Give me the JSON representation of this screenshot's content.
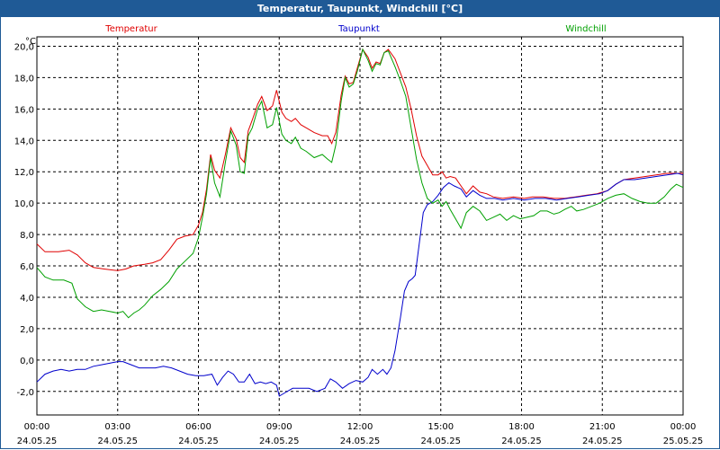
{
  "window_title": "Temperatur, Taupunkt, Windchill [°C]",
  "chart_data": {
    "type": "line",
    "title": "Temperatur, Taupunkt, Windchill [°C]",
    "ylabel": "°C",
    "ylim": [
      -3.5,
      20.6
    ],
    "yticks": [
      "20,0",
      "18,0",
      "16,0",
      "14,0",
      "12,0",
      "10,0",
      "8,0",
      "6,0",
      "4,0",
      "2,0",
      "0,0",
      "-2,0"
    ],
    "xlim": [
      0,
      24
    ],
    "xticks": [
      {
        "time": "00:00",
        "date": "24.05.25"
      },
      {
        "time": "03:00",
        "date": "24.05.25"
      },
      {
        "time": "06:00",
        "date": "24.05.25"
      },
      {
        "time": "09:00",
        "date": "24.05.25"
      },
      {
        "time": "12:00",
        "date": "24.05.25"
      },
      {
        "time": "15:00",
        "date": "24.05.25"
      },
      {
        "time": "18:00",
        "date": "24.05.25"
      },
      {
        "time": "21:00",
        "date": "24.05.25"
      },
      {
        "time": "00:00",
        "date": "25.05.25"
      }
    ],
    "grid": true,
    "legend_position": "top",
    "series": [
      {
        "name": "Temperatur",
        "color": "#e00000",
        "points": [
          [
            0,
            7.4
          ],
          [
            0.3,
            6.9
          ],
          [
            0.8,
            6.9
          ],
          [
            1.2,
            7.0
          ],
          [
            1.5,
            6.7
          ],
          [
            1.8,
            6.2
          ],
          [
            2.1,
            5.9
          ],
          [
            2.5,
            5.8
          ],
          [
            3.0,
            5.7
          ],
          [
            3.3,
            5.8
          ],
          [
            3.6,
            6.0
          ],
          [
            4.0,
            6.1
          ],
          [
            4.3,
            6.2
          ],
          [
            4.6,
            6.4
          ],
          [
            4.9,
            7.0
          ],
          [
            5.2,
            7.7
          ],
          [
            5.5,
            7.9
          ],
          [
            5.8,
            8.0
          ],
          [
            6.0,
            8.6
          ],
          [
            6.15,
            9.4
          ],
          [
            6.3,
            10.9
          ],
          [
            6.45,
            13.1
          ],
          [
            6.6,
            12.1
          ],
          [
            6.8,
            11.6
          ],
          [
            7.0,
            13.1
          ],
          [
            7.2,
            14.8
          ],
          [
            7.4,
            14.1
          ],
          [
            7.55,
            12.9
          ],
          [
            7.7,
            12.6
          ],
          [
            7.85,
            14.6
          ],
          [
            8.0,
            15.3
          ],
          [
            8.2,
            16.3
          ],
          [
            8.35,
            16.8
          ],
          [
            8.55,
            15.9
          ],
          [
            8.75,
            16.2
          ],
          [
            8.9,
            17.2
          ],
          [
            9.1,
            15.8
          ],
          [
            9.25,
            15.4
          ],
          [
            9.45,
            15.2
          ],
          [
            9.6,
            15.4
          ],
          [
            9.8,
            15.0
          ],
          [
            10.0,
            14.8
          ],
          [
            10.3,
            14.5
          ],
          [
            10.6,
            14.3
          ],
          [
            10.8,
            14.3
          ],
          [
            10.95,
            13.8
          ],
          [
            11.1,
            14.5
          ],
          [
            11.3,
            16.9
          ],
          [
            11.45,
            18.1
          ],
          [
            11.6,
            17.6
          ],
          [
            11.75,
            17.7
          ],
          [
            11.9,
            18.6
          ],
          [
            12.1,
            19.8
          ],
          [
            12.3,
            19.3
          ],
          [
            12.45,
            18.6
          ],
          [
            12.6,
            19.0
          ],
          [
            12.75,
            18.9
          ],
          [
            12.9,
            19.6
          ],
          [
            13.05,
            19.8
          ],
          [
            13.3,
            19.2
          ],
          [
            13.5,
            18.3
          ],
          [
            13.7,
            17.4
          ],
          [
            13.9,
            16.0
          ],
          [
            14.1,
            14.3
          ],
          [
            14.3,
            13.0
          ],
          [
            14.5,
            12.4
          ],
          [
            14.7,
            11.8
          ],
          [
            14.9,
            11.8
          ],
          [
            15.05,
            12.0
          ],
          [
            15.2,
            11.6
          ],
          [
            15.35,
            11.7
          ],
          [
            15.55,
            11.6
          ],
          [
            15.75,
            11.1
          ],
          [
            15.95,
            10.6
          ],
          [
            16.2,
            11.1
          ],
          [
            16.45,
            10.7
          ],
          [
            16.7,
            10.6
          ],
          [
            16.95,
            10.4
          ],
          [
            17.3,
            10.3
          ],
          [
            17.7,
            10.4
          ],
          [
            18.1,
            10.3
          ],
          [
            18.4,
            10.4
          ],
          [
            18.8,
            10.4
          ],
          [
            19.2,
            10.3
          ],
          [
            19.6,
            10.3
          ],
          [
            20.0,
            10.4
          ],
          [
            20.4,
            10.5
          ],
          [
            20.8,
            10.6
          ],
          [
            21.2,
            10.8
          ],
          [
            21.5,
            11.2
          ],
          [
            21.8,
            11.5
          ],
          [
            22.2,
            11.6
          ],
          [
            22.6,
            11.7
          ],
          [
            23.0,
            11.8
          ],
          [
            23.4,
            11.9
          ],
          [
            23.8,
            11.9
          ],
          [
            24,
            11.9
          ]
        ]
      },
      {
        "name": "Taupunkt",
        "color": "#0000cc",
        "points": [
          [
            0,
            -1.4
          ],
          [
            0.3,
            -0.9
          ],
          [
            0.6,
            -0.7
          ],
          [
            0.9,
            -0.6
          ],
          [
            1.2,
            -0.7
          ],
          [
            1.5,
            -0.6
          ],
          [
            1.8,
            -0.6
          ],
          [
            2.1,
            -0.4
          ],
          [
            2.4,
            -0.3
          ],
          [
            2.7,
            -0.2
          ],
          [
            3.0,
            -0.1
          ],
          [
            3.2,
            -0.1
          ],
          [
            3.5,
            -0.3
          ],
          [
            3.8,
            -0.5
          ],
          [
            4.1,
            -0.5
          ],
          [
            4.4,
            -0.5
          ],
          [
            4.7,
            -0.4
          ],
          [
            5.0,
            -0.5
          ],
          [
            5.3,
            -0.7
          ],
          [
            5.6,
            -0.9
          ],
          [
            5.9,
            -1.0
          ],
          [
            6.2,
            -1.0
          ],
          [
            6.5,
            -0.9
          ],
          [
            6.7,
            -1.6
          ],
          [
            6.9,
            -1.1
          ],
          [
            7.1,
            -0.7
          ],
          [
            7.3,
            -0.9
          ],
          [
            7.5,
            -1.4
          ],
          [
            7.7,
            -1.4
          ],
          [
            7.9,
            -0.9
          ],
          [
            8.1,
            -1.5
          ],
          [
            8.3,
            -1.4
          ],
          [
            8.5,
            -1.5
          ],
          [
            8.7,
            -1.4
          ],
          [
            8.9,
            -1.6
          ],
          [
            9.0,
            -2.3
          ],
          [
            9.2,
            -2.1
          ],
          [
            9.5,
            -1.8
          ],
          [
            9.8,
            -1.8
          ],
          [
            10.1,
            -1.8
          ],
          [
            10.4,
            -2.0
          ],
          [
            10.7,
            -1.8
          ],
          [
            10.9,
            -1.2
          ],
          [
            11.1,
            -1.4
          ],
          [
            11.35,
            -1.8
          ],
          [
            11.6,
            -1.5
          ],
          [
            11.85,
            -1.3
          ],
          [
            12.1,
            -1.4
          ],
          [
            12.3,
            -1.1
          ],
          [
            12.45,
            -0.6
          ],
          [
            12.65,
            -0.9
          ],
          [
            12.85,
            -0.6
          ],
          [
            13.0,
            -0.9
          ],
          [
            13.15,
            -0.5
          ],
          [
            13.3,
            0.6
          ],
          [
            13.5,
            2.7
          ],
          [
            13.65,
            4.4
          ],
          [
            13.8,
            5.0
          ],
          [
            13.95,
            5.2
          ],
          [
            14.05,
            5.4
          ],
          [
            14.2,
            7.4
          ],
          [
            14.35,
            9.4
          ],
          [
            14.5,
            9.9
          ],
          [
            14.7,
            10.1
          ],
          [
            14.9,
            10.5
          ],
          [
            15.1,
            11.0
          ],
          [
            15.3,
            11.3
          ],
          [
            15.5,
            11.1
          ],
          [
            15.75,
            10.9
          ],
          [
            15.95,
            10.4
          ],
          [
            16.2,
            10.8
          ],
          [
            16.45,
            10.5
          ],
          [
            16.7,
            10.3
          ],
          [
            17.0,
            10.3
          ],
          [
            17.3,
            10.2
          ],
          [
            17.7,
            10.3
          ],
          [
            18.1,
            10.2
          ],
          [
            18.5,
            10.3
          ],
          [
            18.9,
            10.3
          ],
          [
            19.3,
            10.2
          ],
          [
            19.7,
            10.3
          ],
          [
            20.1,
            10.4
          ],
          [
            20.5,
            10.5
          ],
          [
            20.9,
            10.6
          ],
          [
            21.2,
            10.8
          ],
          [
            21.5,
            11.2
          ],
          [
            21.8,
            11.5
          ],
          [
            22.2,
            11.5
          ],
          [
            22.6,
            11.6
          ],
          [
            23.0,
            11.7
          ],
          [
            23.4,
            11.8
          ],
          [
            23.8,
            11.9
          ],
          [
            24,
            11.8
          ]
        ]
      },
      {
        "name": "Windchill",
        "color": "#00a000",
        "points": [
          [
            0,
            5.9
          ],
          [
            0.3,
            5.3
          ],
          [
            0.6,
            5.1
          ],
          [
            1.0,
            5.1
          ],
          [
            1.3,
            4.9
          ],
          [
            1.5,
            3.9
          ],
          [
            1.8,
            3.4
          ],
          [
            2.1,
            3.1
          ],
          [
            2.4,
            3.2
          ],
          [
            2.7,
            3.1
          ],
          [
            3.0,
            3.0
          ],
          [
            3.2,
            3.1
          ],
          [
            3.4,
            2.7
          ],
          [
            3.6,
            3.0
          ],
          [
            3.8,
            3.2
          ],
          [
            4.0,
            3.5
          ],
          [
            4.3,
            4.1
          ],
          [
            4.6,
            4.5
          ],
          [
            4.9,
            5.0
          ],
          [
            5.2,
            5.8
          ],
          [
            5.5,
            6.3
          ],
          [
            5.8,
            6.8
          ],
          [
            6.0,
            7.8
          ],
          [
            6.15,
            9.1
          ],
          [
            6.3,
            10.6
          ],
          [
            6.45,
            12.9
          ],
          [
            6.6,
            11.3
          ],
          [
            6.8,
            10.4
          ],
          [
            7.0,
            12.6
          ],
          [
            7.2,
            14.6
          ],
          [
            7.4,
            13.7
          ],
          [
            7.55,
            12.0
          ],
          [
            7.7,
            11.9
          ],
          [
            7.85,
            14.3
          ],
          [
            8.0,
            14.8
          ],
          [
            8.2,
            16.0
          ],
          [
            8.35,
            16.5
          ],
          [
            8.55,
            14.8
          ],
          [
            8.75,
            15.0
          ],
          [
            8.9,
            16.1
          ],
          [
            9.1,
            14.4
          ],
          [
            9.25,
            14.0
          ],
          [
            9.45,
            13.8
          ],
          [
            9.6,
            14.2
          ],
          [
            9.8,
            13.5
          ],
          [
            10.0,
            13.3
          ],
          [
            10.3,
            12.9
          ],
          [
            10.6,
            13.1
          ],
          [
            10.8,
            12.8
          ],
          [
            10.95,
            12.6
          ],
          [
            11.1,
            13.7
          ],
          [
            11.3,
            16.5
          ],
          [
            11.45,
            18.0
          ],
          [
            11.6,
            17.4
          ],
          [
            11.75,
            17.6
          ],
          [
            11.9,
            18.4
          ],
          [
            12.1,
            19.8
          ],
          [
            12.3,
            19.1
          ],
          [
            12.45,
            18.4
          ],
          [
            12.6,
            18.9
          ],
          [
            12.75,
            18.8
          ],
          [
            12.9,
            19.6
          ],
          [
            13.05,
            19.7
          ],
          [
            13.3,
            18.7
          ],
          [
            13.5,
            17.8
          ],
          [
            13.7,
            16.8
          ],
          [
            13.9,
            14.8
          ],
          [
            14.1,
            12.8
          ],
          [
            14.3,
            11.3
          ],
          [
            14.5,
            10.3
          ],
          [
            14.7,
            10.0
          ],
          [
            14.9,
            10.2
          ],
          [
            15.05,
            9.8
          ],
          [
            15.2,
            10.1
          ],
          [
            15.35,
            9.6
          ],
          [
            15.55,
            9.0
          ],
          [
            15.75,
            8.4
          ],
          [
            15.95,
            9.4
          ],
          [
            16.2,
            9.8
          ],
          [
            16.45,
            9.5
          ],
          [
            16.7,
            8.9
          ],
          [
            16.95,
            9.1
          ],
          [
            17.2,
            9.3
          ],
          [
            17.45,
            8.9
          ],
          [
            17.7,
            9.2
          ],
          [
            17.95,
            9.0
          ],
          [
            18.2,
            9.1
          ],
          [
            18.45,
            9.2
          ],
          [
            18.7,
            9.5
          ],
          [
            18.95,
            9.5
          ],
          [
            19.2,
            9.3
          ],
          [
            19.4,
            9.4
          ],
          [
            19.6,
            9.6
          ],
          [
            19.85,
            9.8
          ],
          [
            20.05,
            9.5
          ],
          [
            20.3,
            9.6
          ],
          [
            20.6,
            9.8
          ],
          [
            20.9,
            10.0
          ],
          [
            21.2,
            10.3
          ],
          [
            21.5,
            10.5
          ],
          [
            21.8,
            10.6
          ],
          [
            22.1,
            10.3
          ],
          [
            22.4,
            10.1
          ],
          [
            22.7,
            10.0
          ],
          [
            23.0,
            10.0
          ],
          [
            23.3,
            10.4
          ],
          [
            23.55,
            10.9
          ],
          [
            23.75,
            11.2
          ],
          [
            24,
            11.0
          ]
        ]
      }
    ]
  }
}
